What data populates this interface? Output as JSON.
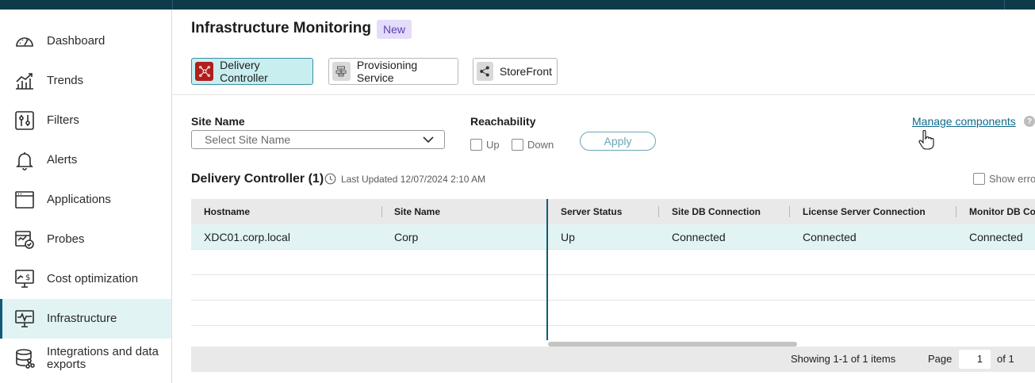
{
  "sidebar": {
    "items": [
      {
        "label": "Dashboard",
        "icon": "dashboard-gauge-icon"
      },
      {
        "label": "Trends",
        "icon": "trends-chart-icon"
      },
      {
        "label": "Filters",
        "icon": "filters-sliders-icon"
      },
      {
        "label": "Alerts",
        "icon": "alerts-bell-icon"
      },
      {
        "label": "Applications",
        "icon": "applications-window-icon"
      },
      {
        "label": "Probes",
        "icon": "probes-calendar-check-icon"
      },
      {
        "label": "Cost optimization",
        "icon": "cost-monitor-dollar-icon"
      },
      {
        "label": "Infrastructure",
        "icon": "infrastructure-monitor-pulse-icon",
        "active": true
      },
      {
        "label": "Integrations and data exports",
        "icon": "integrations-database-icon"
      }
    ]
  },
  "header": {
    "title": "Infrastructure Monitoring",
    "badge": "New"
  },
  "components": [
    {
      "label": "Delivery Controller",
      "icon": "delivery-controller-icon",
      "selected": true,
      "icon_bg": "#b01e1e"
    },
    {
      "label": "Provisioning Service",
      "icon": "provisioning-service-icon",
      "selected": false,
      "icon_bg": "#d9d9d9"
    },
    {
      "label": "StoreFront",
      "icon": "storefront-share-icon",
      "selected": false,
      "icon_bg": "#d9d9d9"
    }
  ],
  "filters": {
    "site_name_label": "Site Name",
    "site_name_placeholder": "Select Site Name",
    "reachability_label": "Reachability",
    "reach_up": "Up",
    "reach_down": "Down",
    "apply": "Apply"
  },
  "manage_components": "Manage components",
  "help": "?",
  "section": {
    "title": "Delivery Controller (1)",
    "last_updated": "Last Updated 12/07/2024 2:10 AM",
    "show_errors": "Show erro"
  },
  "table": {
    "columns": [
      "Hostname",
      "Site Name",
      "Server Status",
      "Site DB Connection",
      "License Server Connection",
      "Monitor DB Con"
    ],
    "rows": [
      [
        "XDC01.corp.local",
        "Corp",
        "Up",
        "Connected",
        "Connected",
        "Connected"
      ]
    ]
  },
  "pagination": {
    "showing": "Showing 1-1 of 1 items",
    "page_label": "Page",
    "page_value": "1",
    "of": "of 1"
  },
  "colors": {
    "topbar": "#0e3a4a",
    "active_nav": "#e2f3f4",
    "accent": "#0e5a78",
    "badge_bg": "#e4dcfa",
    "link": "#0e6a8a"
  }
}
